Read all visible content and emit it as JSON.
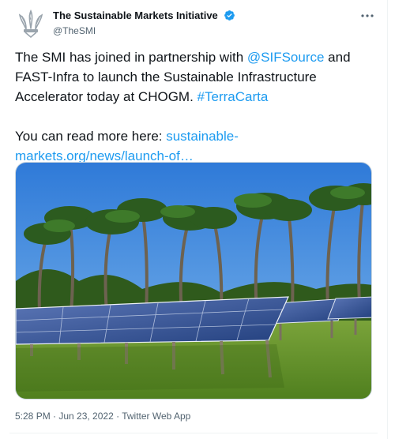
{
  "account": {
    "display_name": "The Sustainable Markets Initiative",
    "handle": "@TheSMI",
    "verified": true,
    "avatar_icon": "prince-of-wales-feathers-logo"
  },
  "tweet": {
    "line1_text": "The SMI has joined in partnership with ",
    "mention": "@SIFSource",
    "line2_text": " and FAST-Infra to launch the Sustainable Infrastructure Accelerator today at CHOGM. ",
    "hashtag": "#TerraCarta",
    "read_more_text": "You can read more here: ",
    "link_text": "sustainable-markets.org/news/launch-of…"
  },
  "media": {
    "image_subject": "solar panels among palm trees"
  },
  "meta": {
    "timestamp": "5:28 PM · Jun 23, 2022 · Twitter Web App"
  },
  "colors": {
    "link": "#1d9bf0",
    "verified": "#1d9bf0",
    "secondary_text": "#536471"
  }
}
